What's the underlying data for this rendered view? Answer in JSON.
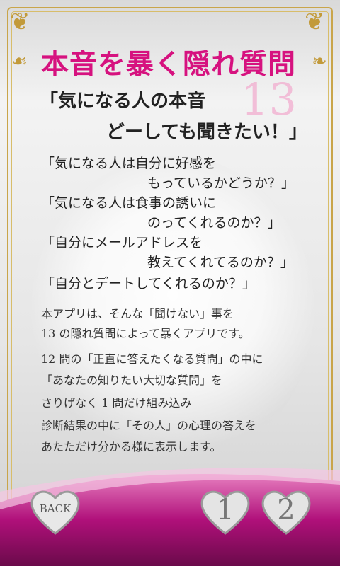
{
  "header": {
    "title": "本音を暴く隠れ質問",
    "number": "13",
    "subtitle_line1": "「気になる人の本音",
    "subtitle_line2": "どーしても聞きたい！」"
  },
  "questions": [
    {
      "line1": "「気になる人は自分に好感を",
      "line2": "もっているかどうか？」"
    },
    {
      "line1": "「気になる人は食事の誘いに",
      "line2": "のってくれるのか？」"
    },
    {
      "line1": "「自分にメールアドレスを",
      "line2": "教えてくれてるのか？」"
    },
    {
      "line1": "「自分とデートしてくれるのか？」",
      "line2": ""
    }
  ],
  "description": {
    "p1_line1": "本アプリは、そんな「聞けない」事を",
    "p1_line2": "13 の隠れ質問によって暴くアプリです。",
    "p2_line1": "12 問の「正直に答えたくなる質問」の中に",
    "p2_line2": "「あなたの知りたい大切な質問」を",
    "p2_line3": "さりげなく 1 問だけ組み込み",
    "p2_line4": "診断結果の中に「その人」の心理の答えを",
    "p2_line5": "あたただけ分かる様に表示します。"
  },
  "buttons": {
    "back_label": "BACK",
    "page1_label": "1",
    "page2_label": "2"
  },
  "colors": {
    "accent": "#d6127f",
    "gold": "#c29a3a",
    "wave": "#b0107a"
  }
}
